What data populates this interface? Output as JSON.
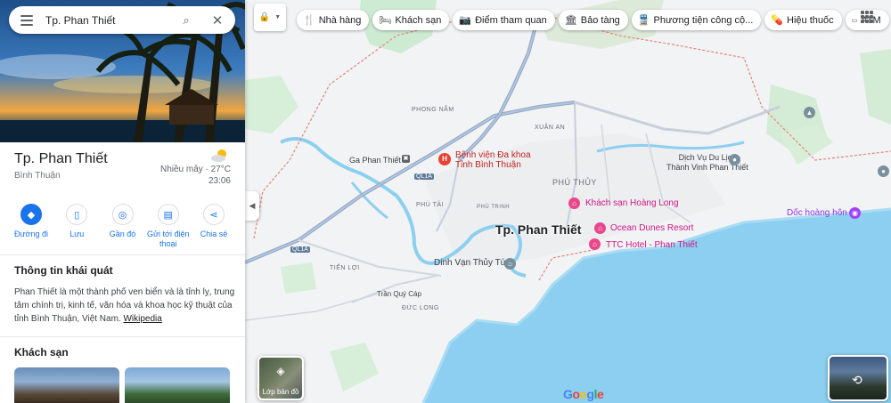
{
  "search": {
    "query": "Tp. Phan Thiết"
  },
  "place": {
    "title": "Tp. Phan Thiết",
    "subtitle": "Bình Thuận",
    "weather": {
      "condition": "Nhiều mây · 27°C",
      "time": "23:06"
    }
  },
  "actions": [
    {
      "label": "Đường đi",
      "icon": "directions-icon"
    },
    {
      "label": "Lưu",
      "icon": "bookmark-icon"
    },
    {
      "label": "Gần đó",
      "icon": "nearby-icon"
    },
    {
      "label_line1": "Gửi tới điện",
      "label_line2": "thoại",
      "icon": "send-to-phone-icon"
    },
    {
      "label": "Chia sẻ",
      "icon": "share-icon"
    }
  ],
  "overview": {
    "title": "Thông tin khái quát",
    "text": "Phan Thiết là một thành phố ven biển và là tỉnh lỵ, trung tâm chính trị, kinh tế, văn hóa và khoa học kỹ thuật của tỉnh Bình Thuận, Việt Nam.",
    "link": "Wikipedia"
  },
  "hotels": {
    "title": "Khách sạn"
  },
  "chips": [
    {
      "label": "Nhà hàng",
      "icon": "restaurant-icon"
    },
    {
      "label": "Khách sạn",
      "icon": "hotel-icon"
    },
    {
      "label": "Điểm tham quan",
      "icon": "camera-icon"
    },
    {
      "label": "Bảo tàng",
      "icon": "museum-icon"
    },
    {
      "label": "Phương tiện công cộ...",
      "icon": "transit-icon"
    },
    {
      "label": "Hiệu thuốc",
      "icon": "pharmacy-icon"
    },
    {
      "label": "ATM",
      "icon": "atm-icon"
    }
  ],
  "map": {
    "city_label": "Tp. Phan Thiết",
    "labels": {
      "phong_nam": "PHONG NẪM",
      "xuan_an": "XUÂN AN",
      "phu_thuy": "PHÚ THỦY",
      "phu_tai": "PHÚ TÀI",
      "phu_trinh": "PHÚ TRINH",
      "tien_loi": "TIẾN LỢI",
      "duc_long": "ĐỨC LONG",
      "tran_quy_cap": "Trần Quý Cáp",
      "ga": "Ga Phan Thiết",
      "hospital_line1": "Bệnh viện Đa khoa",
      "hospital_line2": "Tỉnh Bình Thuận",
      "hoang_long": "Khách sạn Hoàng Long",
      "ocean_dunes": "Ocean Dunes Resort",
      "ttc": "TTC Hotel - Phan Thiết",
      "dinh_van": "Dinh Vạn Thủy Tú",
      "dulich_line1": "Dịch Vụ Du Lịch",
      "dulich_line2": "Thành Vinh Phan Thiết",
      "doc_hoang_hon": "Dốc hoàng hôn",
      "road_ql1a_1": "QL1A",
      "road_ql1a_2": "QL1A"
    },
    "layers_label": "Lớp bản đồ",
    "google": "Google"
  }
}
